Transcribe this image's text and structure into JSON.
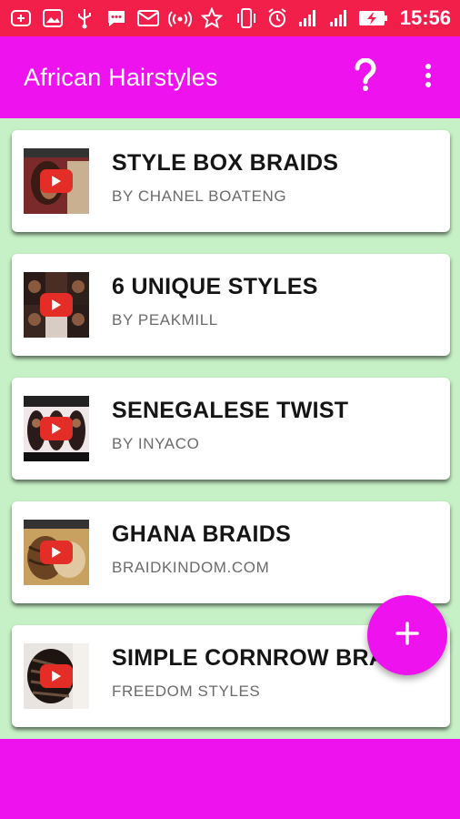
{
  "status_bar": {
    "time": "15:56",
    "bg_color": "#f21f4a",
    "icons": [
      "add-box-icon",
      "image-icon",
      "usb-icon",
      "chat-icon",
      "mail-icon",
      "wifi-hotspot-icon",
      "star-icon",
      "phone-vibrate-icon",
      "alarm-icon",
      "signal-icon",
      "signal-icon",
      "battery-charging-icon"
    ]
  },
  "app_bar": {
    "title": "African Hairstyles",
    "bg_color": "#ee12ee",
    "actions": [
      "help-icon",
      "more-vert-icon"
    ]
  },
  "list": {
    "bg_color": "#c6f0c6",
    "items": [
      {
        "title": "STYLE BOX BRAIDS",
        "subtitle": "BY CHANEL BOATENG"
      },
      {
        "title": "6 UNIQUE STYLES",
        "subtitle": "BY PEAKMILL"
      },
      {
        "title": "SENEGALESE TWIST",
        "subtitle": "BY INYACO"
      },
      {
        "title": "GHANA BRAIDS",
        "subtitle": "BRAIDKINDOM.COM"
      },
      {
        "title": "SIMPLE CORNROW BRAIDS",
        "subtitle": "FREEDOM STYLES"
      }
    ]
  },
  "fab": {
    "icon": "plus-icon"
  },
  "accent_color": "#ee12ee",
  "play_button_color": "#e52d27"
}
